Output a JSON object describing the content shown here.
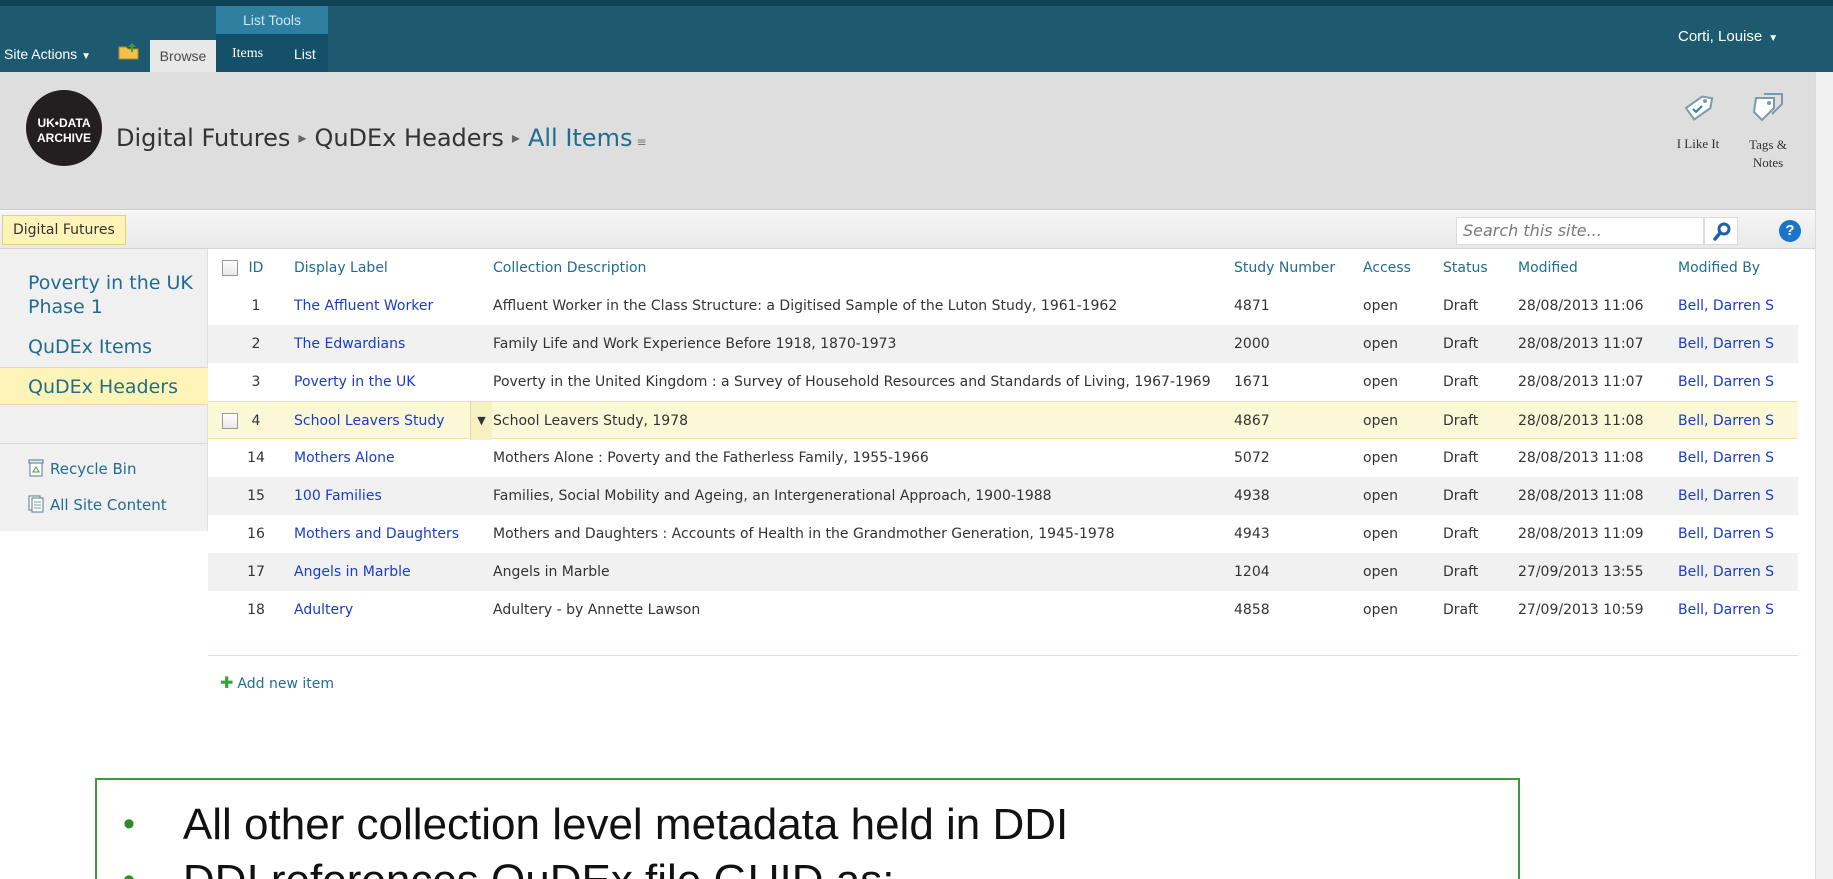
{
  "ribbon": {
    "site_actions": "Site Actions",
    "tab_browse": "Browse",
    "list_tools": "List Tools",
    "tab_items": "Items",
    "tab_list": "List",
    "user": "Corti, Louise"
  },
  "logo": {
    "line1": "UK•DATA",
    "line2": "ARCHIVE"
  },
  "breadcrumb": {
    "site": "Digital Futures",
    "list": "QuDEx Headers",
    "view": "All Items"
  },
  "social": {
    "like": "I Like It",
    "tags": "Tags & Notes"
  },
  "topnav": {
    "item": "Digital Futures"
  },
  "search": {
    "placeholder": "Search this site..."
  },
  "quicklaunch": {
    "items": [
      "Poverty in the UK Phase 1",
      "QuDEx Items",
      "QuDEx Headers"
    ],
    "recycle": "Recycle Bin",
    "all_content": "All Site Content"
  },
  "table": {
    "headers": {
      "id": "ID",
      "label": "Display Label",
      "desc": "Collection Description",
      "study": "Study Number",
      "access": "Access",
      "status": "Status",
      "modified": "Modified",
      "by": "Modified By"
    },
    "rows": [
      {
        "id": "1",
        "label": "The Affluent Worker",
        "desc": "Affluent Worker in the Class Structure: a Digitised Sample of the Luton Study, 1961-1962",
        "study": "4871",
        "access": "open",
        "status": "Draft",
        "modified": "28/08/2013 11:06",
        "by": "Bell, Darren S"
      },
      {
        "id": "2",
        "label": "The Edwardians",
        "desc": "Family Life and Work Experience Before 1918, 1870-1973",
        "study": "2000",
        "access": "open",
        "status": "Draft",
        "modified": "28/08/2013 11:07",
        "by": "Bell, Darren S"
      },
      {
        "id": "3",
        "label": "Poverty in the UK",
        "desc": "Poverty in the United Kingdom : a Survey of Household Resources and Standards of Living, 1967-1969",
        "study": "1671",
        "access": "open",
        "status": "Draft",
        "modified": "28/08/2013 11:07",
        "by": "Bell, Darren S"
      },
      {
        "id": "4",
        "label": "School Leavers Study",
        "desc": "School Leavers Study, 1978",
        "study": "4867",
        "access": "open",
        "status": "Draft",
        "modified": "28/08/2013 11:08",
        "by": "Bell, Darren S"
      },
      {
        "id": "14",
        "label": "Mothers Alone",
        "desc": "Mothers Alone : Poverty and the Fatherless Family, 1955-1966",
        "study": "5072",
        "access": "open",
        "status": "Draft",
        "modified": "28/08/2013 11:08",
        "by": "Bell, Darren S"
      },
      {
        "id": "15",
        "label": "100 Families",
        "desc": "Families, Social Mobility and Ageing, an Intergenerational Approach, 1900-1988",
        "study": "4938",
        "access": "open",
        "status": "Draft",
        "modified": "28/08/2013 11:08",
        "by": "Bell, Darren S"
      },
      {
        "id": "16",
        "label": "Mothers and Daughters",
        "desc": "Mothers and Daughters : Accounts of Health in the Grandmother Generation, 1945-1978",
        "study": "4943",
        "access": "open",
        "status": "Draft",
        "modified": "28/08/2013 11:09",
        "by": "Bell, Darren S"
      },
      {
        "id": "17",
        "label": "Angels in Marble",
        "desc": "Angels in Marble",
        "study": "1204",
        "access": "open",
        "status": "Draft",
        "modified": "27/09/2013 13:55",
        "by": "Bell, Darren S"
      },
      {
        "id": "18",
        "label": "Adultery",
        "desc": "Adultery - by Annette Lawson",
        "study": "4858",
        "access": "open",
        "status": "Draft",
        "modified": "27/09/2013 10:59",
        "by": "Bell, Darren S"
      }
    ],
    "add_new": "Add new item"
  },
  "callout": {
    "bullets": [
      "All other collection level metadata held in DDI",
      "DDI references QuDEx file GUID as:"
    ]
  },
  "colors": {
    "ribbon": "#1d5a70",
    "link": "#1a3cc8",
    "accent": "#1f6d8f",
    "highlight": "#fff4b8",
    "callout_border": "#3c9a3c"
  }
}
